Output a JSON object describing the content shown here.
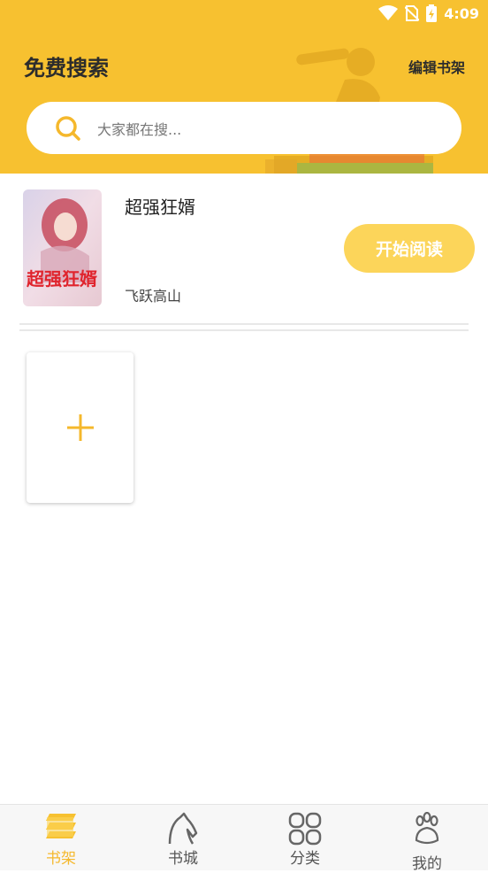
{
  "status_bar": {
    "time": "4:09"
  },
  "header": {
    "title": "免费搜索",
    "edit_label": "编辑书架",
    "search_placeholder": "大家都在搜..."
  },
  "books": [
    {
      "title": "超强狂婿",
      "author": "飞跃高山",
      "read_label": "开始阅读",
      "cover_text": "超强狂婿"
    }
  ],
  "add_book_symbol": "+",
  "bottom_nav": [
    {
      "label": "书架",
      "icon": "bookshelf-icon",
      "active": true
    },
    {
      "label": "书城",
      "icon": "horse-icon",
      "active": false
    },
    {
      "label": "分类",
      "icon": "category-grid-icon",
      "active": false
    },
    {
      "label": "我的",
      "icon": "paw-icon",
      "active": false
    }
  ],
  "colors": {
    "accent": "#f7c130",
    "read_button": "#fcd55a",
    "nav_active": "#f5b82c",
    "nav_inactive": "#555555"
  }
}
